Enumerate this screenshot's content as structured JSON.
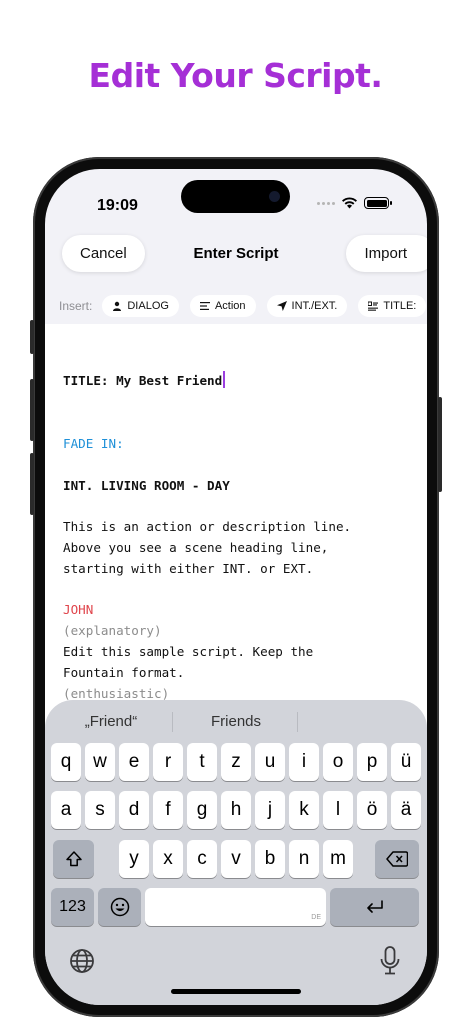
{
  "headline": {
    "text": "Edit Your Script.",
    "color": "#a52fd6"
  },
  "status_bar": {
    "time": "19:09"
  },
  "nav": {
    "cancel_label": "Cancel",
    "title": "Enter Script",
    "import_label": "Import"
  },
  "insert_bar": {
    "label": "Insert:",
    "chips": [
      {
        "label": "DIALOG",
        "icon": "person-icon"
      },
      {
        "label": "Action",
        "icon": "lines-icon"
      },
      {
        "label": "INT./EXT.",
        "icon": "location-arrow-icon"
      },
      {
        "label": "TITLE:",
        "icon": "title-card-icon"
      }
    ]
  },
  "script": {
    "title_line": "TITLE: My Best Friend",
    "fade_in": "FADE IN:",
    "scene_heading": "INT. LIVING ROOM - DAY",
    "action_lines": [
      "This is an action or description line.",
      "Above you see a scene heading line,",
      "starting with either INT. or EXT."
    ],
    "character": "JOHN",
    "parenthetical_1": "(explanatory)",
    "dialog_lines": [
      "Edit this sample script. Keep the",
      "Fountain format."
    ],
    "parenthetical_2": "(enthusiastic)"
  },
  "keyboard": {
    "suggestions": [
      "„Friend“",
      "Friends",
      ""
    ],
    "row1": [
      "q",
      "w",
      "e",
      "r",
      "t",
      "z",
      "u",
      "i",
      "o",
      "p",
      "ü"
    ],
    "row2": [
      "a",
      "s",
      "d",
      "f",
      "g",
      "h",
      "j",
      "k",
      "l",
      "ö",
      "ä"
    ],
    "row3": [
      "y",
      "x",
      "c",
      "v",
      "b",
      "n",
      "m"
    ],
    "numbers_label": "123",
    "space_language_tag": "DE"
  }
}
